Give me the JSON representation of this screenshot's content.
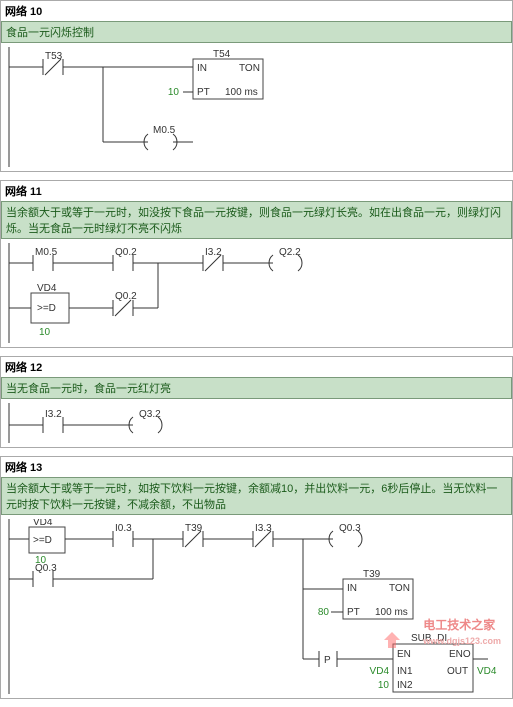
{
  "networks": [
    {
      "id": "net10",
      "title": "网络 10",
      "comment": "食品一元闪烁控制",
      "elements": {
        "contact_T53": "T53",
        "timer_name": "T54",
        "timer_type": "TON",
        "timer_in": "IN",
        "timer_pt_lbl": "PT",
        "timer_pt_val": "10",
        "timer_time": "100 ms",
        "coil_M05": "M0.5"
      }
    },
    {
      "id": "net11",
      "title": "网络 11",
      "comment": "当余额大于或等于一元时，如没按下食品一元按键，则食品一元绿灯长亮。如在出食品一元，则绿灯闪烁。当无食品一元时绿灯不亮不闪烁",
      "elements": {
        "c_M05": "M0.5",
        "c_Q02a": "Q0.2",
        "c_I32": "I3.2",
        "coil_Q22": "Q2.2",
        "cmp_var": "VD4",
        "cmp_op": ">=D",
        "cmp_val": "10",
        "c_Q02b": "Q0.2"
      }
    },
    {
      "id": "net12",
      "title": "网络 12",
      "comment": "当无食品一元时，食品一元红灯亮",
      "elements": {
        "c_I32": "I3.2",
        "coil_Q32": "Q3.2"
      }
    },
    {
      "id": "net13",
      "title": "网络 13",
      "comment": "当余额大于或等于一元时，如按下饮料一元按键，余额减10，并出饮料一元，6秒后停止。当无饮料一元时按下饮料一元按键，不减余额，不出物品",
      "elements": {
        "cmp_var": "VD4",
        "cmp_op": ">=D",
        "cmp_val": "10",
        "c_I03": "I0.3",
        "c_T39": "T39",
        "c_I33": "I3.3",
        "coil_Q03": "Q0.3",
        "c_Q03": "Q0.3",
        "timer_name": "T39",
        "timer_type": "TON",
        "timer_in": "IN",
        "timer_pt_lbl": "PT",
        "timer_pt_val": "80",
        "timer_time": "100 ms",
        "p_contact": "P",
        "sub_name": "SUB_DI",
        "sub_en": "EN",
        "sub_eno": "ENO",
        "sub_in1_lbl": "IN1",
        "sub_in1_val": "VD4",
        "sub_in2_lbl": "IN2",
        "sub_in2_val": "10",
        "sub_out_lbl": "OUT",
        "sub_out_val": "VD4"
      }
    }
  ],
  "watermark": "电工技术之家",
  "watermark_url": "www.dgjs123.com"
}
